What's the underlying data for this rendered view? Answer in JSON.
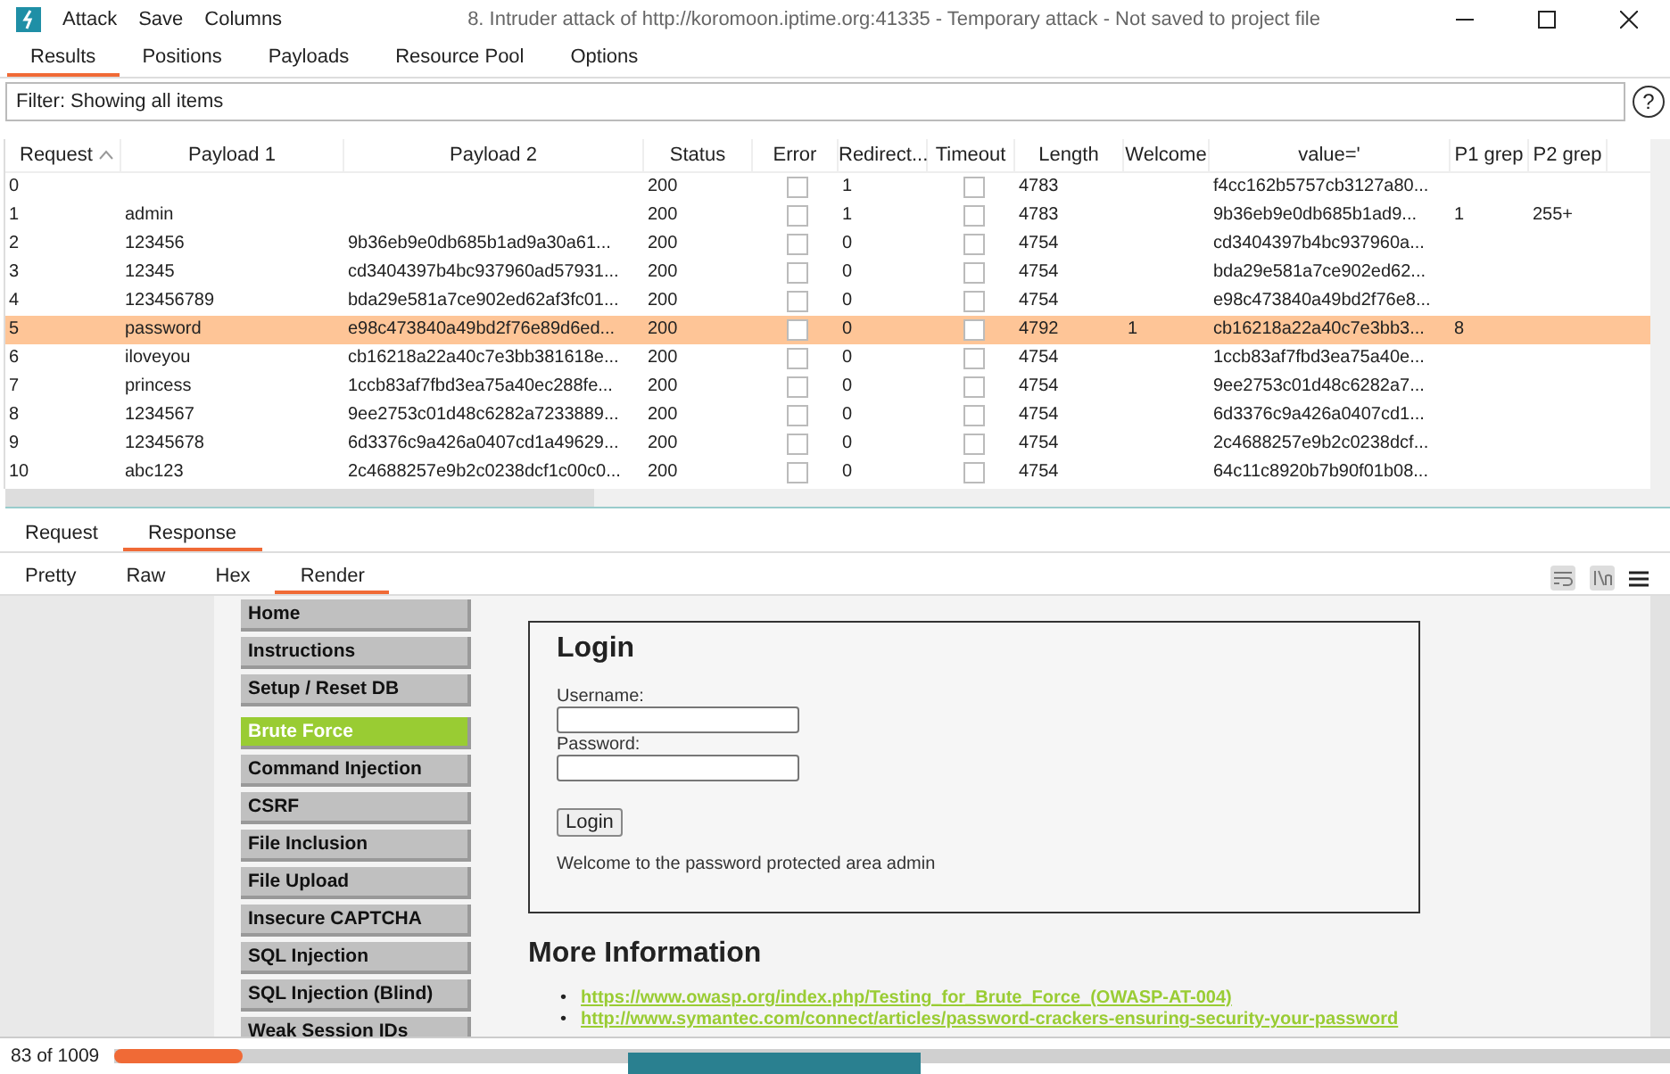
{
  "window": {
    "title": "8. Intruder attack of http://koromoon.iptime.org:41335 - Temporary attack - Not saved to project file",
    "menu": [
      "Attack",
      "Save",
      "Columns"
    ]
  },
  "tabs": [
    {
      "label": "Results",
      "selected": true
    },
    {
      "label": "Positions",
      "selected": false
    },
    {
      "label": "Payloads",
      "selected": false
    },
    {
      "label": "Resource Pool",
      "selected": false
    },
    {
      "label": "Options",
      "selected": false
    }
  ],
  "filter": {
    "value": "Filter: Showing all items",
    "help": "?"
  },
  "table": {
    "columns": [
      "Request",
      "Payload 1",
      "Payload 2",
      "Status",
      "Error",
      "Redirect...",
      "Timeout",
      "Length",
      "Welcome",
      "value='",
      "P1 grep",
      "P2 grep"
    ],
    "rows": [
      {
        "request": "0",
        "payload1": "",
        "payload2": "",
        "status": "200",
        "error": false,
        "redirects": "1",
        "timeout": false,
        "length": "4783",
        "welcome": "",
        "value": "f4cc162b5757cb3127a80...",
        "p1grep": "",
        "p2grep": "",
        "selected": false
      },
      {
        "request": "1",
        "payload1": "admin",
        "payload2": "",
        "status": "200",
        "error": false,
        "redirects": "1",
        "timeout": false,
        "length": "4783",
        "welcome": "",
        "value": "9b36eb9e0db685b1ad9...",
        "p1grep": "1",
        "p2grep": "255+",
        "selected": false
      },
      {
        "request": "2",
        "payload1": "123456",
        "payload2": "9b36eb9e0db685b1ad9a30a61...",
        "status": "200",
        "error": false,
        "redirects": "0",
        "timeout": false,
        "length": "4754",
        "welcome": "",
        "value": "cd3404397b4bc937960a...",
        "p1grep": "",
        "p2grep": "",
        "selected": false
      },
      {
        "request": "3",
        "payload1": "12345",
        "payload2": "cd3404397b4bc937960ad57931...",
        "status": "200",
        "error": false,
        "redirects": "0",
        "timeout": false,
        "length": "4754",
        "welcome": "",
        "value": "bda29e581a7ce902ed62...",
        "p1grep": "",
        "p2grep": "",
        "selected": false
      },
      {
        "request": "4",
        "payload1": "123456789",
        "payload2": "bda29e581a7ce902ed62af3fc01...",
        "status": "200",
        "error": false,
        "redirects": "0",
        "timeout": false,
        "length": "4754",
        "welcome": "",
        "value": "e98c473840a49bd2f76e8...",
        "p1grep": "",
        "p2grep": "",
        "selected": false
      },
      {
        "request": "5",
        "payload1": "password",
        "payload2": "e98c473840a49bd2f76e89d6ed...",
        "status": "200",
        "error": false,
        "redirects": "0",
        "timeout": false,
        "length": "4792",
        "welcome": "1",
        "value": "cb16218a22a40c7e3bb3...",
        "p1grep": "8",
        "p2grep": "",
        "selected": true
      },
      {
        "request": "6",
        "payload1": "iloveyou",
        "payload2": "cb16218a22a40c7e3bb381618e...",
        "status": "200",
        "error": false,
        "redirects": "0",
        "timeout": false,
        "length": "4754",
        "welcome": "",
        "value": "1ccb83af7fbd3ea75a40e...",
        "p1grep": "",
        "p2grep": "",
        "selected": false
      },
      {
        "request": "7",
        "payload1": "princess",
        "payload2": "1ccb83af7fbd3ea75a40ec288fe...",
        "status": "200",
        "error": false,
        "redirects": "0",
        "timeout": false,
        "length": "4754",
        "welcome": "",
        "value": "9ee2753c01d48c6282a7...",
        "p1grep": "",
        "p2grep": "",
        "selected": false
      },
      {
        "request": "8",
        "payload1": "1234567",
        "payload2": "9ee2753c01d48c6282a7233889...",
        "status": "200",
        "error": false,
        "redirects": "0",
        "timeout": false,
        "length": "4754",
        "welcome": "",
        "value": "6d3376c9a426a0407cd1...",
        "p1grep": "",
        "p2grep": "",
        "selected": false
      },
      {
        "request": "9",
        "payload1": "12345678",
        "payload2": "6d3376c9a426a0407cd1a49629...",
        "status": "200",
        "error": false,
        "redirects": "0",
        "timeout": false,
        "length": "4754",
        "welcome": "",
        "value": "2c4688257e9b2c0238dcf...",
        "p1grep": "",
        "p2grep": "",
        "selected": false
      },
      {
        "request": "10",
        "payload1": "abc123",
        "payload2": "2c4688257e9b2c0238dcf1c00c0...",
        "status": "200",
        "error": false,
        "redirects": "0",
        "timeout": false,
        "length": "4754",
        "welcome": "",
        "value": "64c11c8920b7b90f01b08...",
        "p1grep": "",
        "p2grep": "",
        "selected": false
      }
    ]
  },
  "message_tabs": [
    {
      "label": "Request",
      "selected": false
    },
    {
      "label": "Response",
      "selected": true
    }
  ],
  "view_tabs": [
    {
      "label": "Pretty",
      "selected": false
    },
    {
      "label": "Raw",
      "selected": false
    },
    {
      "label": "Hex",
      "selected": false
    },
    {
      "label": "Render",
      "selected": true
    }
  ],
  "render": {
    "nav": [
      {
        "label": "Home",
        "selected": false
      },
      {
        "label": "Instructions",
        "selected": false
      },
      {
        "label": "Setup / Reset DB",
        "selected": false
      },
      {
        "label": "Brute Force",
        "selected": true
      },
      {
        "label": "Command Injection",
        "selected": false
      },
      {
        "label": "CSRF",
        "selected": false
      },
      {
        "label": "File Inclusion",
        "selected": false
      },
      {
        "label": "File Upload",
        "selected": false
      },
      {
        "label": "Insecure CAPTCHA",
        "selected": false
      },
      {
        "label": "SQL Injection",
        "selected": false
      },
      {
        "label": "SQL Injection (Blind)",
        "selected": false
      },
      {
        "label": "Weak Session IDs",
        "selected": false
      }
    ],
    "login": {
      "title": "Login",
      "username_label": "Username:",
      "password_label": "Password:",
      "button": "Login",
      "message": "Welcome to the password protected area admin"
    },
    "more_title": "More Information",
    "links": [
      {
        "marker": "•",
        "text": "https://www.owasp.org/index.php/Testing_for_Brute_Force_(OWASP-AT-004)"
      },
      {
        "marker": "•",
        "text": "http://www.symantec.com/connect/articles/password-crackers-ensuring-security-your-password"
      }
    ]
  },
  "status_bar": {
    "progress": "83 of 1009",
    "level": 0.082
  }
}
